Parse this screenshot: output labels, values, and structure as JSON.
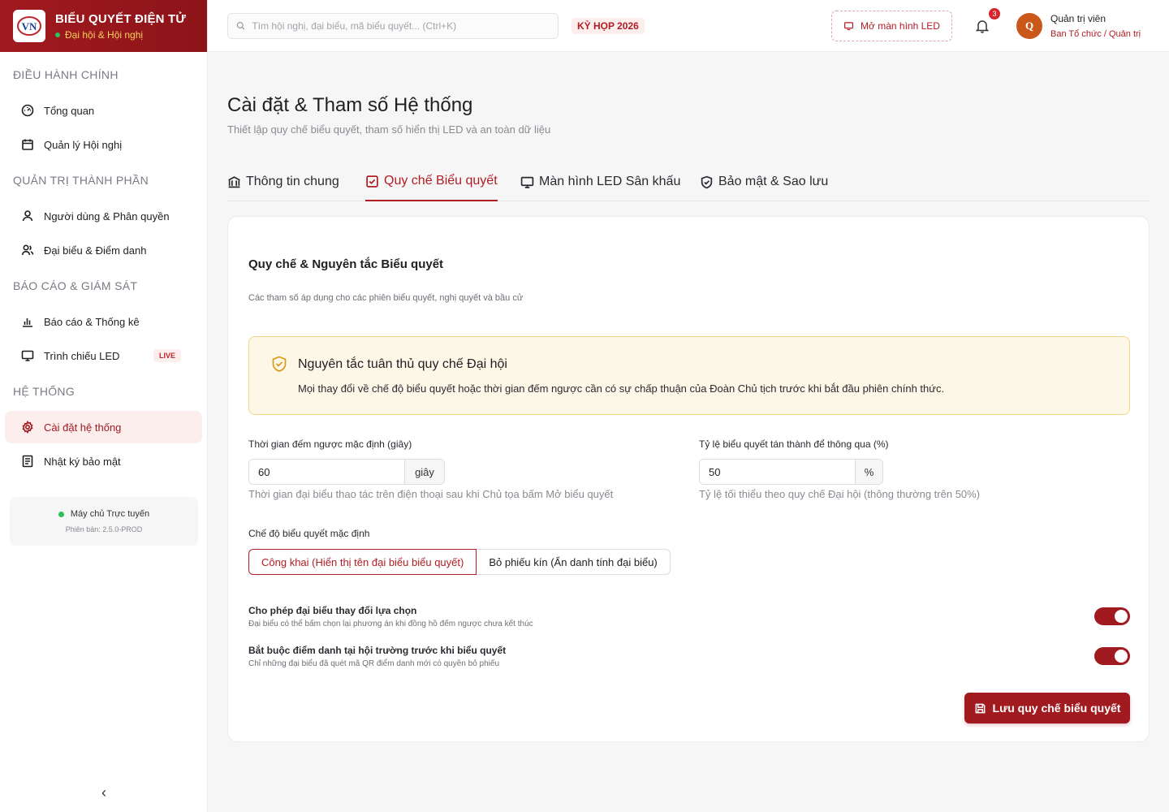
{
  "brand": {
    "title": "BIỂU QUYẾT ĐIỆN TỬ",
    "subtitle": "Đại hội & Hội nghị",
    "logo_text": "VN"
  },
  "sidebar": {
    "sections": [
      {
        "title": "ĐIỀU HÀNH CHÍNH",
        "items": [
          {
            "label": "Tổng quan",
            "icon": "gauge-icon"
          },
          {
            "label": "Quản lý Hội nghị",
            "icon": "calendar-icon"
          }
        ]
      },
      {
        "title": "QUẢN TRỊ THÀNH PHẦN",
        "items": [
          {
            "label": "Người dùng & Phân quyền",
            "icon": "user-icon"
          },
          {
            "label": "Đại biểu & Điểm danh",
            "icon": "users-icon"
          }
        ]
      },
      {
        "title": "BÁO CÁO & GIÁM SÁT",
        "items": [
          {
            "label": "Báo cáo & Thống kê",
            "icon": "bar-chart-icon"
          },
          {
            "label": "Trình chiếu LED",
            "icon": "monitor-icon",
            "badge": "LIVE"
          }
        ]
      },
      {
        "title": "HỆ THỐNG",
        "items": [
          {
            "label": "Cài đặt hệ thống",
            "icon": "gear-icon",
            "active": true
          },
          {
            "label": "Nhật ký bảo mật",
            "icon": "log-icon"
          }
        ]
      }
    ],
    "server_status": "Máy chủ Trực tuyến",
    "version": "Phiên bản: 2.5.0-PROD",
    "collapse_glyph": "‹"
  },
  "header": {
    "search_placeholder": "Tìm hội nghị, đại biểu, mã biểu quyết... (Ctrl+K)",
    "session_badge": "KỲ HỌP 2026",
    "led_button": "Mở màn hình LED",
    "notification_count": "3",
    "user_initial": "Q",
    "user_name": "Quản trị viên",
    "user_role": "Ban Tổ chức / Quản trị"
  },
  "page": {
    "title": "Cài đặt & Tham số Hệ thống",
    "subtitle": "Thiết lập quy chế biểu quyết, tham số hiển thị LED và an toàn dữ liệu",
    "tabs": [
      {
        "label": "Thông tin chung",
        "icon": "bank-icon"
      },
      {
        "label": "Quy chế Biểu quyết",
        "icon": "checkbox-icon",
        "active": true
      },
      {
        "label": "Màn hình LED Sân khấu",
        "icon": "monitor-icon"
      },
      {
        "label": "Bảo mật & Sao lưu",
        "icon": "shield-check-icon"
      }
    ]
  },
  "voting_rules": {
    "title": "Quy chế & Nguyên tắc Biểu quyết",
    "subtitle": "Các tham số áp dụng cho các phiên biểu quyết, nghị quyết và bầu cử",
    "notice_title": "Nguyên tắc tuân thủ quy chế Đại hội",
    "notice_text": "Mọi thay đổi về chế độ biểu quyết hoặc thời gian đếm ngược cần có sự chấp thuận của Đoàn Chủ tịch trước khi bắt đầu phiên chính thức.",
    "countdown_label": "Thời gian đếm ngược mặc định (giây)",
    "countdown_value": "60",
    "countdown_unit": "giây",
    "countdown_help": "Thời gian đại biểu thao tác trên điện thoại sau khi Chủ tọa bấm Mở biểu quyết",
    "ratio_label": "Tỷ lệ biểu quyết tán thành để thông qua (%)",
    "ratio_value": "50",
    "ratio_unit": "%",
    "ratio_help": "Tỷ lệ tối thiểu theo quy chế Đại hội (thông thường trên 50%)",
    "mode_label": "Chế độ biểu quyết mặc định",
    "mode_public": "Công khai (Hiển thị tên đại biểu biểu quyết)",
    "mode_secret": "Bỏ phiếu kín (Ẩn danh tính đại biểu)",
    "toggle_change_title": "Cho phép đại biểu thay đổi lựa chọn",
    "toggle_change_desc": "Đại biểu có thể bấm chọn lại phương án khi đồng hồ đếm ngược chưa kết thúc",
    "toggle_change_on": true,
    "toggle_attendance_title": "Bắt buộc điểm danh tại hội trường trước khi biểu quyết",
    "toggle_attendance_desc": "Chỉ những đại biểu đã quét mã QR điểm danh mới có quyền bỏ phiếu",
    "toggle_attendance_on": true,
    "save_button": "Lưu quy chế biểu quyết"
  },
  "colors": {
    "brand_red": "#a11a1f",
    "accent_yellow": "#f6d35a",
    "notice_bg": "#fdf7e8",
    "online_green": "#2fbf5a"
  }
}
